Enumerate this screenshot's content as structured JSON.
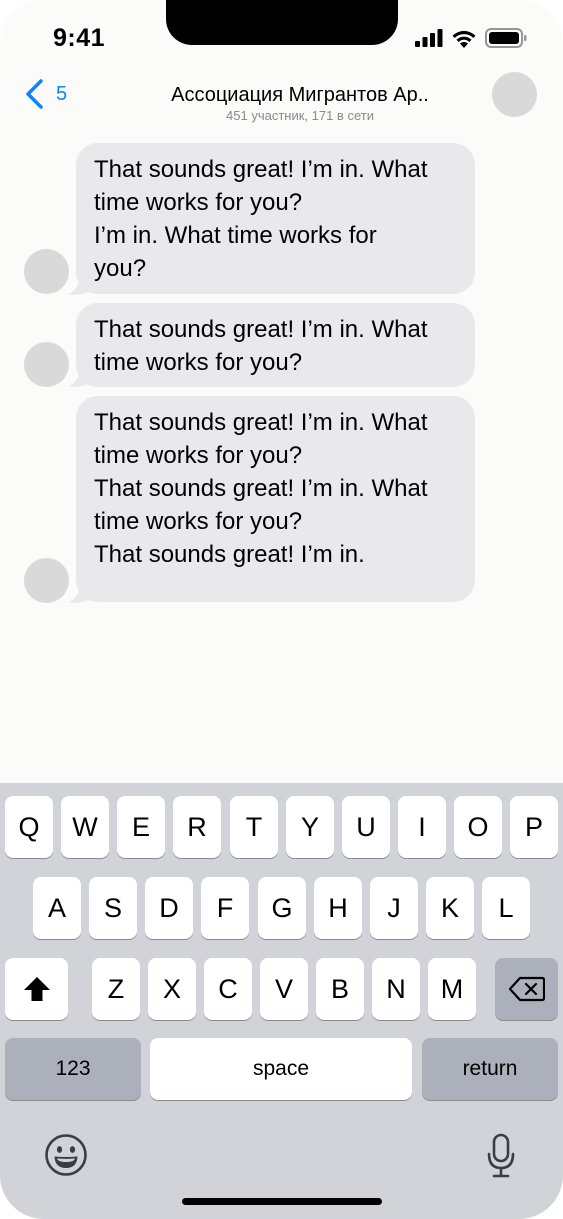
{
  "status_bar": {
    "time": "9:41"
  },
  "header": {
    "back_count": "5",
    "title": "Ассоциация Мигрантов Ар..",
    "subtitle": "451 участник, 171 в сети"
  },
  "messages": [
    {
      "lines": [
        "That sounds great! I’m in. What",
        "time works for you?",
        "I’m in. What time works for",
        "you?"
      ]
    },
    {
      "lines": [
        "That sounds great! I’m in. What",
        "time works for you?"
      ]
    },
    {
      "lines": [
        "That sounds great! I’m in. What",
        "time works for you?",
        "That sounds great! I’m in. What",
        "time works for you?",
        "That sounds great! I’m in."
      ]
    }
  ],
  "keyboard": {
    "row1": [
      "Q",
      "W",
      "E",
      "R",
      "T",
      "Y",
      "U",
      "I",
      "O",
      "P"
    ],
    "row2": [
      "A",
      "S",
      "D",
      "F",
      "G",
      "H",
      "J",
      "K",
      "L"
    ],
    "row3": [
      "Z",
      "X",
      "C",
      "V",
      "B",
      "N",
      "M"
    ],
    "numbers_label": "123",
    "space_label": "space",
    "return_label": "return",
    "shift_icon": "shift-icon",
    "delete_icon": "delete-icon",
    "emoji_icon": "emoji-icon",
    "mic_icon": "microphone-icon"
  },
  "colors": {
    "accent": "#0a84ff",
    "bubble": "#e9e9eb",
    "keyboard_bg": "#d1d3d9"
  }
}
